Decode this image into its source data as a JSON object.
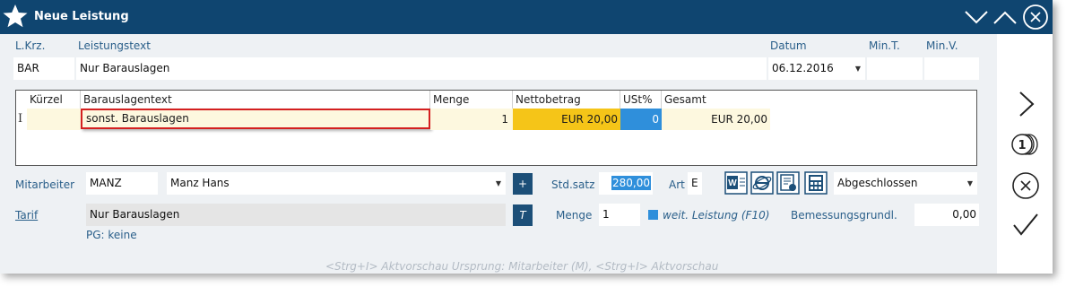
{
  "window": {
    "title": "Neue Leistung"
  },
  "header": {
    "labels": {
      "lkrz": "L.Krz.",
      "leistungstext": "Leistungstext",
      "datum": "Datum",
      "mint": "Min.T.",
      "minv": "Min.V."
    },
    "values": {
      "lkrz": "BAR",
      "leistungstext": "Nur Barauslagen",
      "datum": "06.12.2016",
      "mint": "",
      "minv": ""
    }
  },
  "table": {
    "columns": [
      "Kürzel",
      "Barauslagentext",
      "Menge",
      "Nettobetrag",
      "USt%",
      "Gesamt"
    ],
    "rows": [
      {
        "kuerzel": "",
        "text": "sonst. Barauslagen",
        "menge": "1",
        "netto": "EUR 20,00",
        "ust": "0",
        "gesamt": "EUR 20,00"
      }
    ]
  },
  "form": {
    "mitarbeiter_label": "Mitarbeiter",
    "mitarbeiter_code": "MANZ",
    "mitarbeiter_name": "Manz Hans",
    "plus_label": "+",
    "stdsatz_label": "Std.satz",
    "stdsatz_value": "280,00",
    "art_label": "Art",
    "art_value": "E",
    "status_select": "Abgeschlossen",
    "tarif_label": "Tarif",
    "tarif_value": "Nur Barauslagen",
    "t_label": "T",
    "menge_label": "Menge",
    "menge_value": "1",
    "weit_label": "weit. Leistung (F10)",
    "bemessung_label": "Bemessungsgrundl.",
    "bemessung_value": "0,00",
    "pg_text": "PG: keine"
  },
  "status_hint": "<Strg+I> Aktvorschau Ursprung: Mitarbeiter (M),  <Strg+I> Aktvorschau",
  "colors": {
    "titlebar": "#0f4570",
    "accent": "#2a5f8a",
    "netto_bg": "#f5c518",
    "ust_bg": "#2f8fdb",
    "highlight_border": "#d42020"
  }
}
